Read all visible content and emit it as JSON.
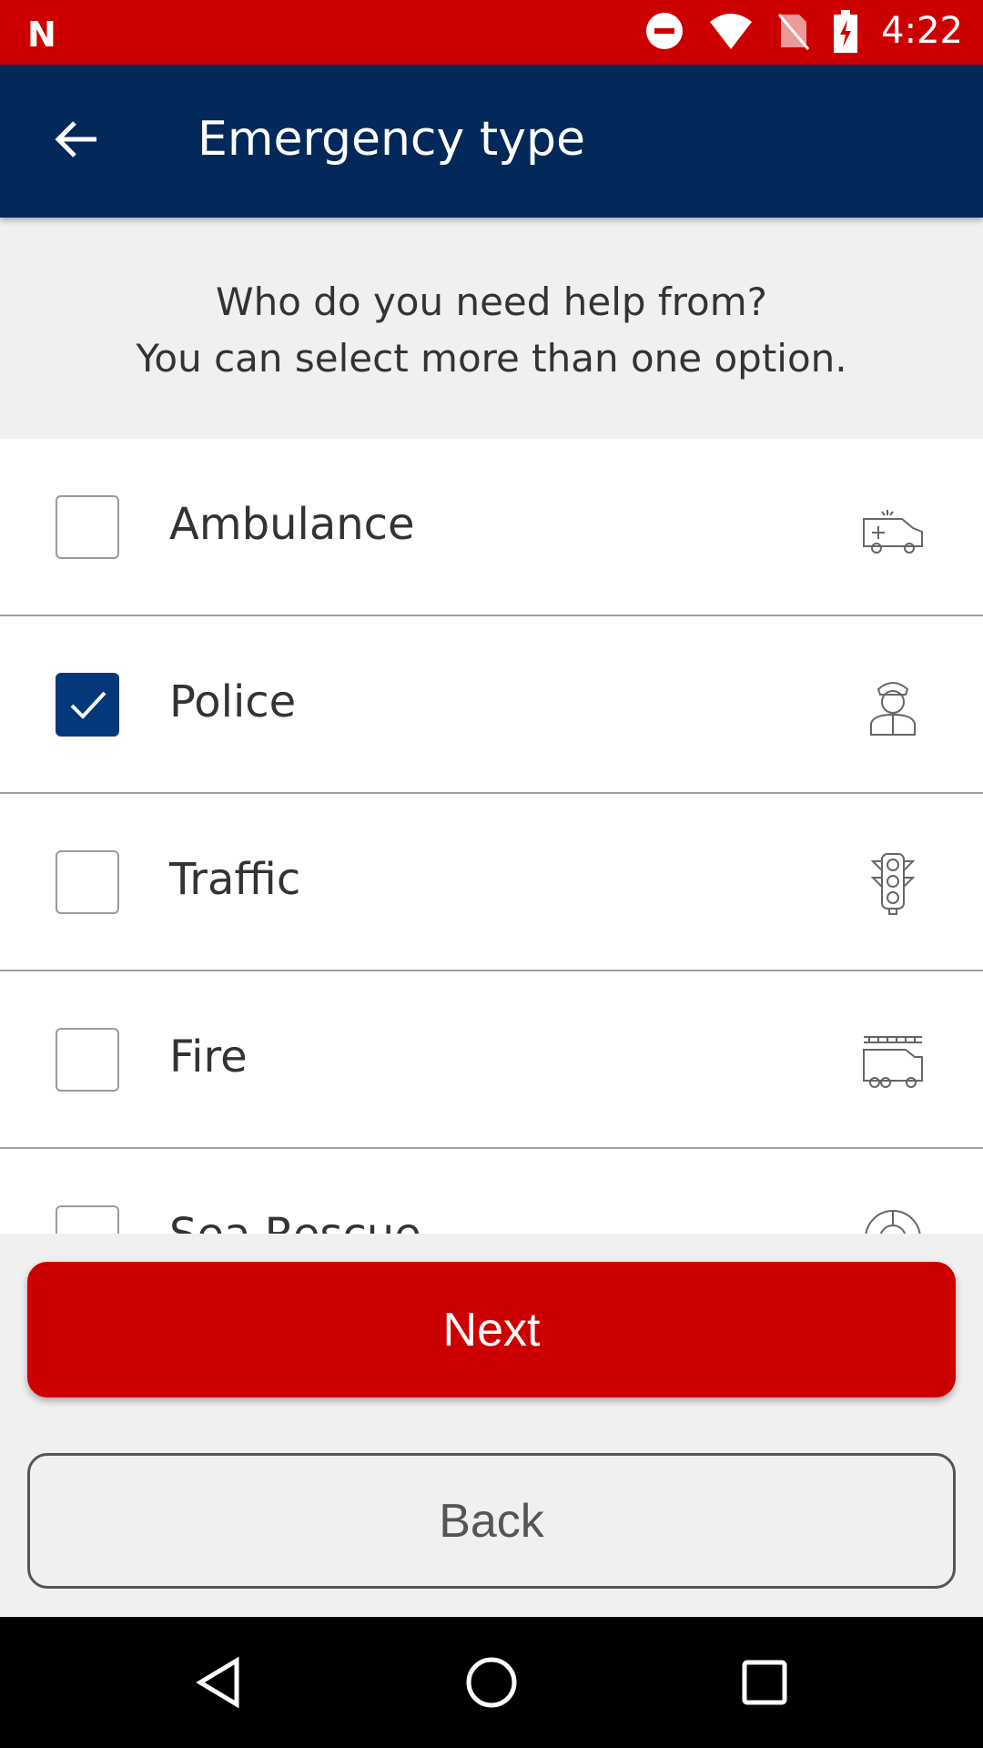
{
  "status_bar": {
    "time": "4:22",
    "icons": [
      "n-logo-icon",
      "do-not-disturb-icon",
      "wifi-icon",
      "no-sim-icon",
      "battery-charging-icon"
    ]
  },
  "app_bar": {
    "title": "Emergency type",
    "back_icon": "arrow-left-icon"
  },
  "intro": {
    "line1": "Who do you need help from?",
    "line2": "You can select more than one option."
  },
  "options": [
    {
      "label": "Ambulance",
      "checked": false,
      "icon": "ambulance-icon"
    },
    {
      "label": "Police",
      "checked": true,
      "icon": "police-officer-icon"
    },
    {
      "label": "Traffic",
      "checked": false,
      "icon": "traffic-light-icon"
    },
    {
      "label": "Fire",
      "checked": false,
      "icon": "fire-truck-icon"
    },
    {
      "label": "Sea Rescue",
      "checked": false,
      "icon": "lifebuoy-icon"
    }
  ],
  "buttons": {
    "next": "Next",
    "back": "Back"
  },
  "colors": {
    "primary_red": "#cc0000",
    "navy": "#03295b",
    "checkbox_checked": "#03397a"
  }
}
